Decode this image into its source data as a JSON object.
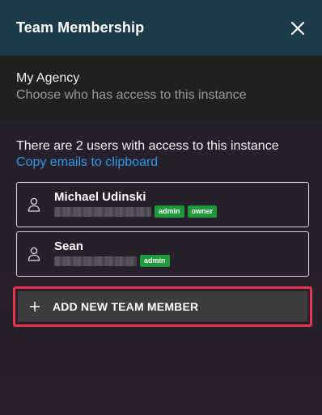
{
  "header": {
    "title": "Team Membership",
    "close_icon": "close-icon"
  },
  "org": {
    "name": "My Agency",
    "subtitle": "Choose who has access to this instance"
  },
  "access": {
    "summary": "There are 2 users with access to this instance",
    "copy_emails_link": "Copy emails to clipboard"
  },
  "members": [
    {
      "name": "Michael Udinski",
      "icon": "user-icon",
      "badges": [
        "admin",
        "owner"
      ]
    },
    {
      "name": "Sean",
      "icon": "user-icon",
      "badges": [
        "admin"
      ]
    }
  ],
  "add_member": {
    "label": "ADD NEW TEAM MEMBER",
    "icon": "plus-icon"
  },
  "colors": {
    "header_bg": "#1c3a4a",
    "org_bg": "#202020",
    "link": "#2f9be8",
    "badge": "#1f9a3a",
    "highlight": "#e8344a",
    "button_bg": "#3d3d3d"
  }
}
